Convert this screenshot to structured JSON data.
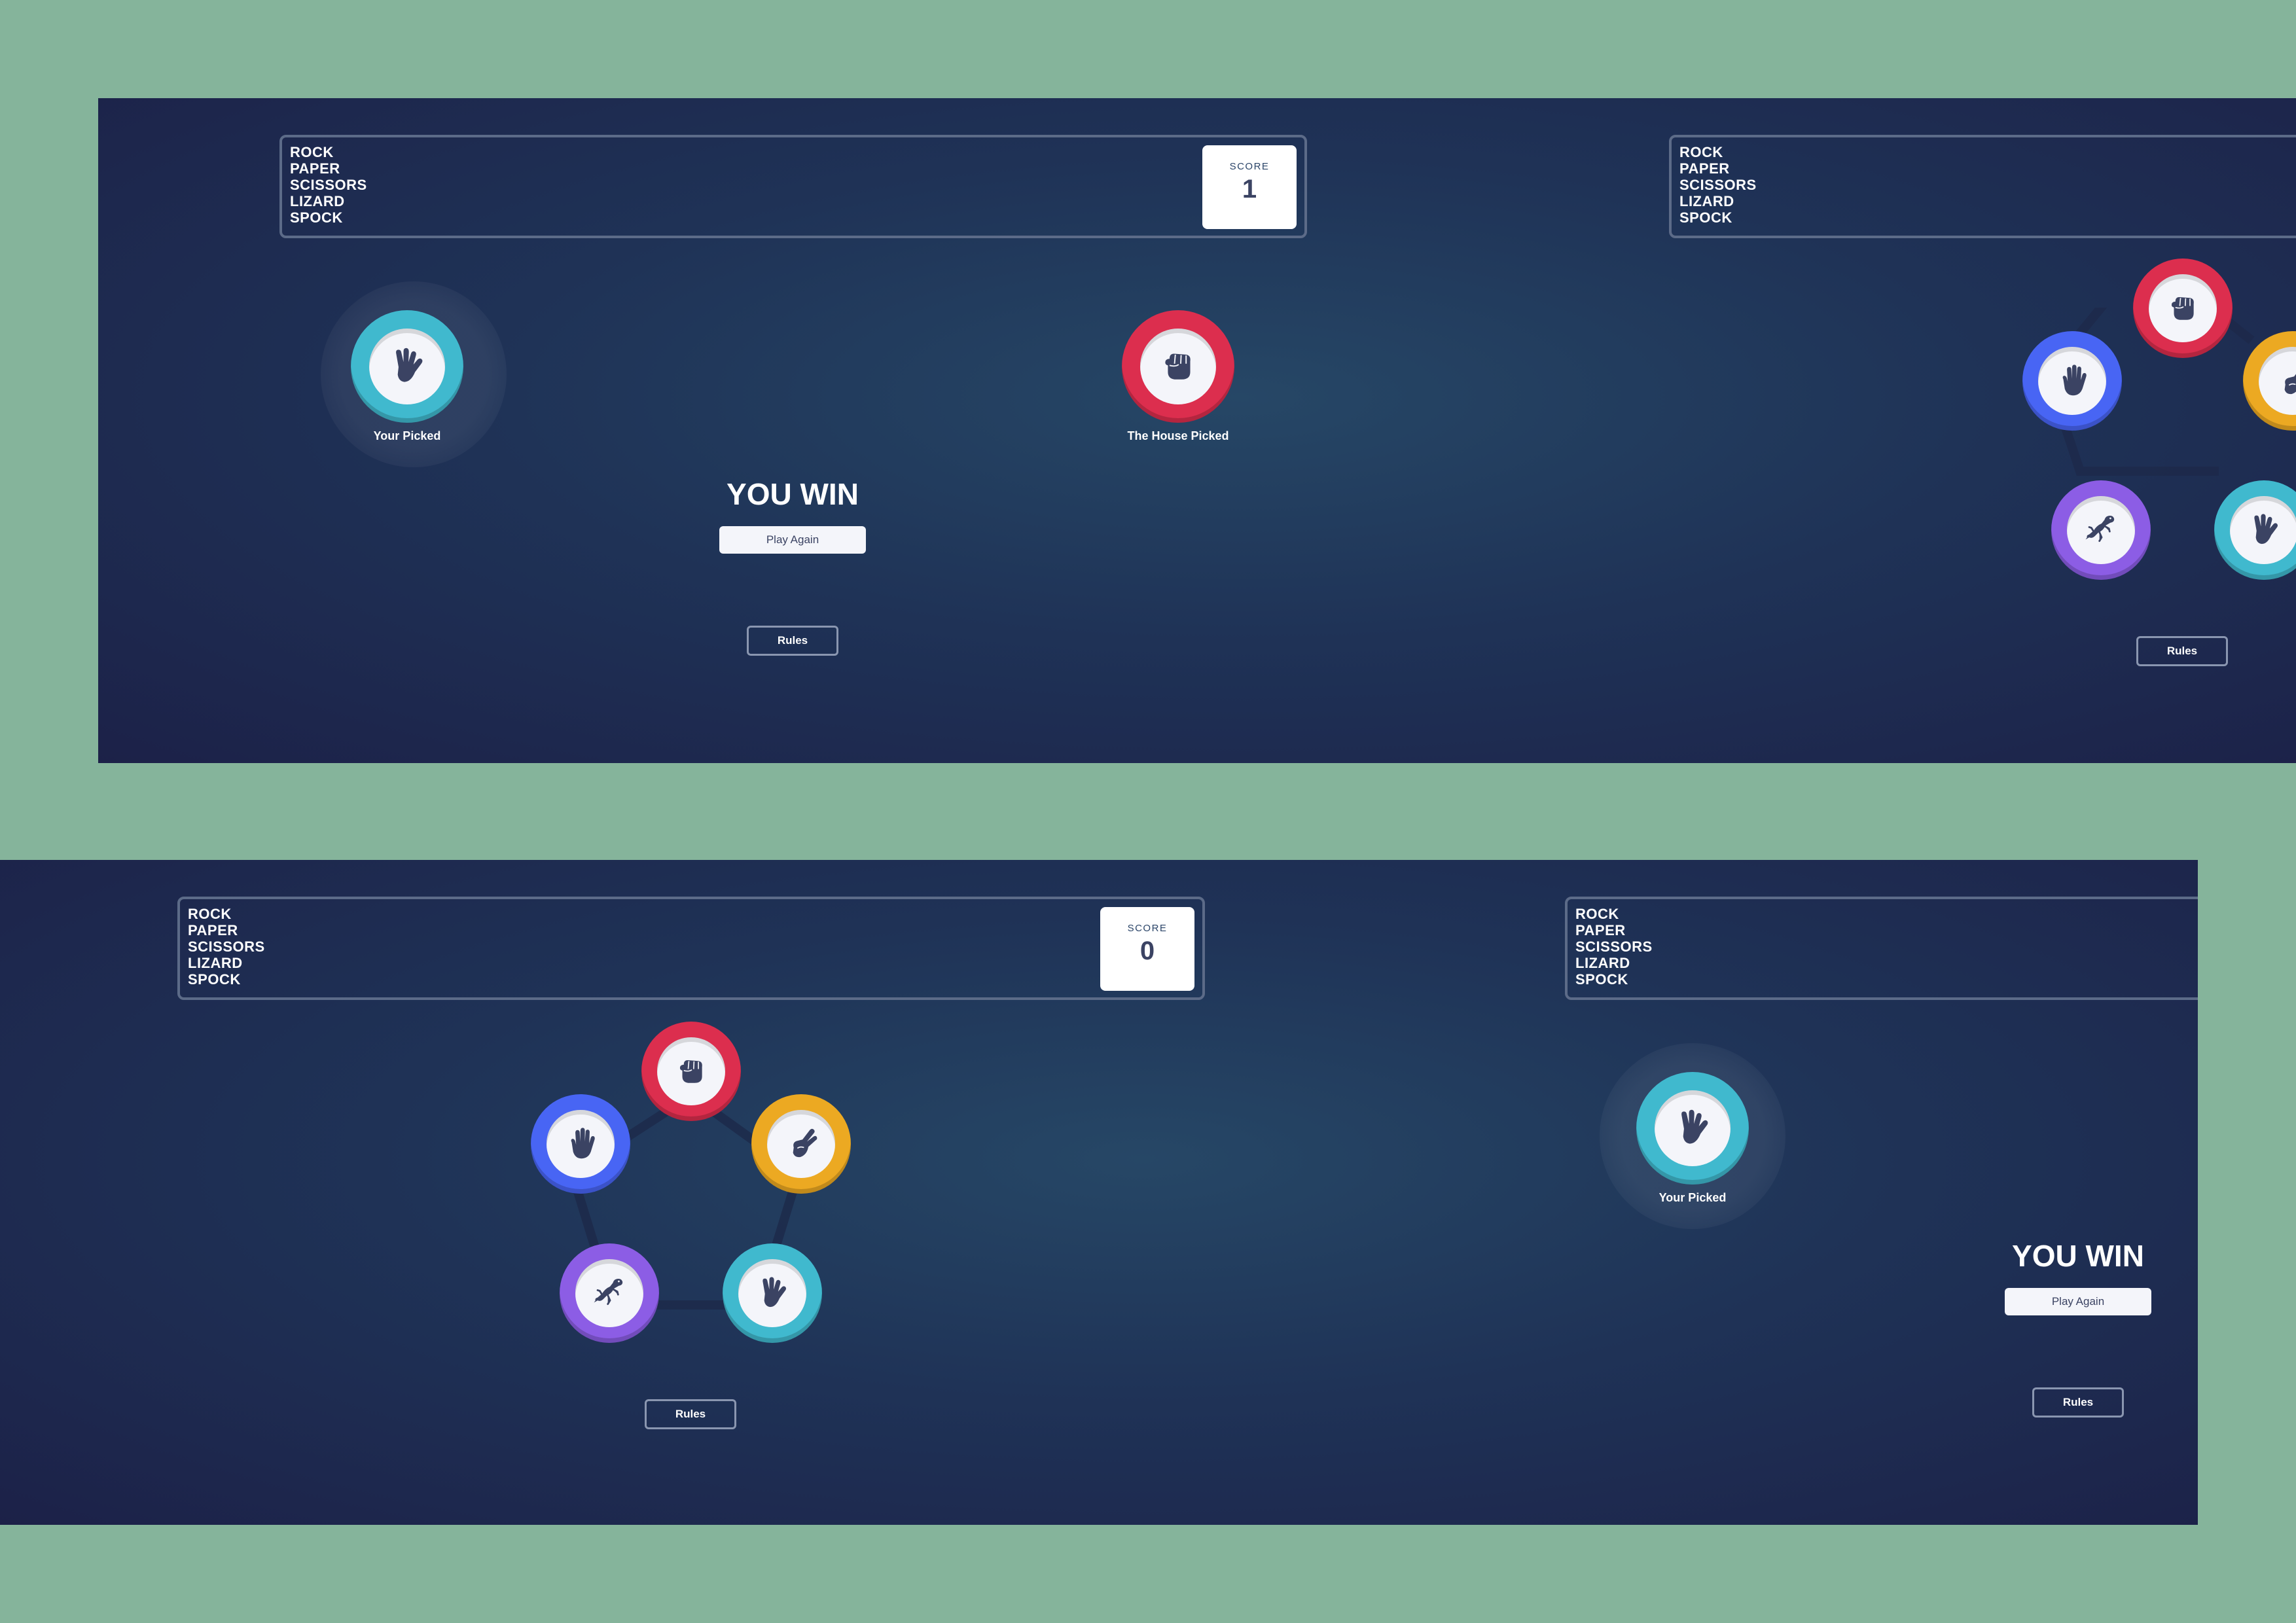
{
  "brand": [
    "ROCK",
    "PAPER",
    "SCISSORS",
    "LIZARD",
    "SPOCK"
  ],
  "score_label": "SCORE",
  "screens": [
    {
      "score": "1",
      "your_label": "Your Picked",
      "house_label": "The House Picked",
      "result": "YOU WIN",
      "play_again": "Play Again",
      "rules": "Rules"
    },
    {
      "score": "0",
      "your_label": "Your Picked",
      "result": "YOU WIN",
      "play_again": "Play Again",
      "rules": "Rules"
    }
  ],
  "colors": {
    "rock": "#dc2e4e",
    "paper": "#4865f4",
    "scissors": "#eca922",
    "lizard": "#8c5de5",
    "spock": "#40b9ce",
    "background": "#85b49b"
  },
  "icons": {
    "rock": "fist-icon",
    "paper": "open-hand-icon",
    "scissors": "scissors-hand-icon",
    "lizard": "lizard-icon",
    "spock": "vulcan-salute-icon"
  }
}
